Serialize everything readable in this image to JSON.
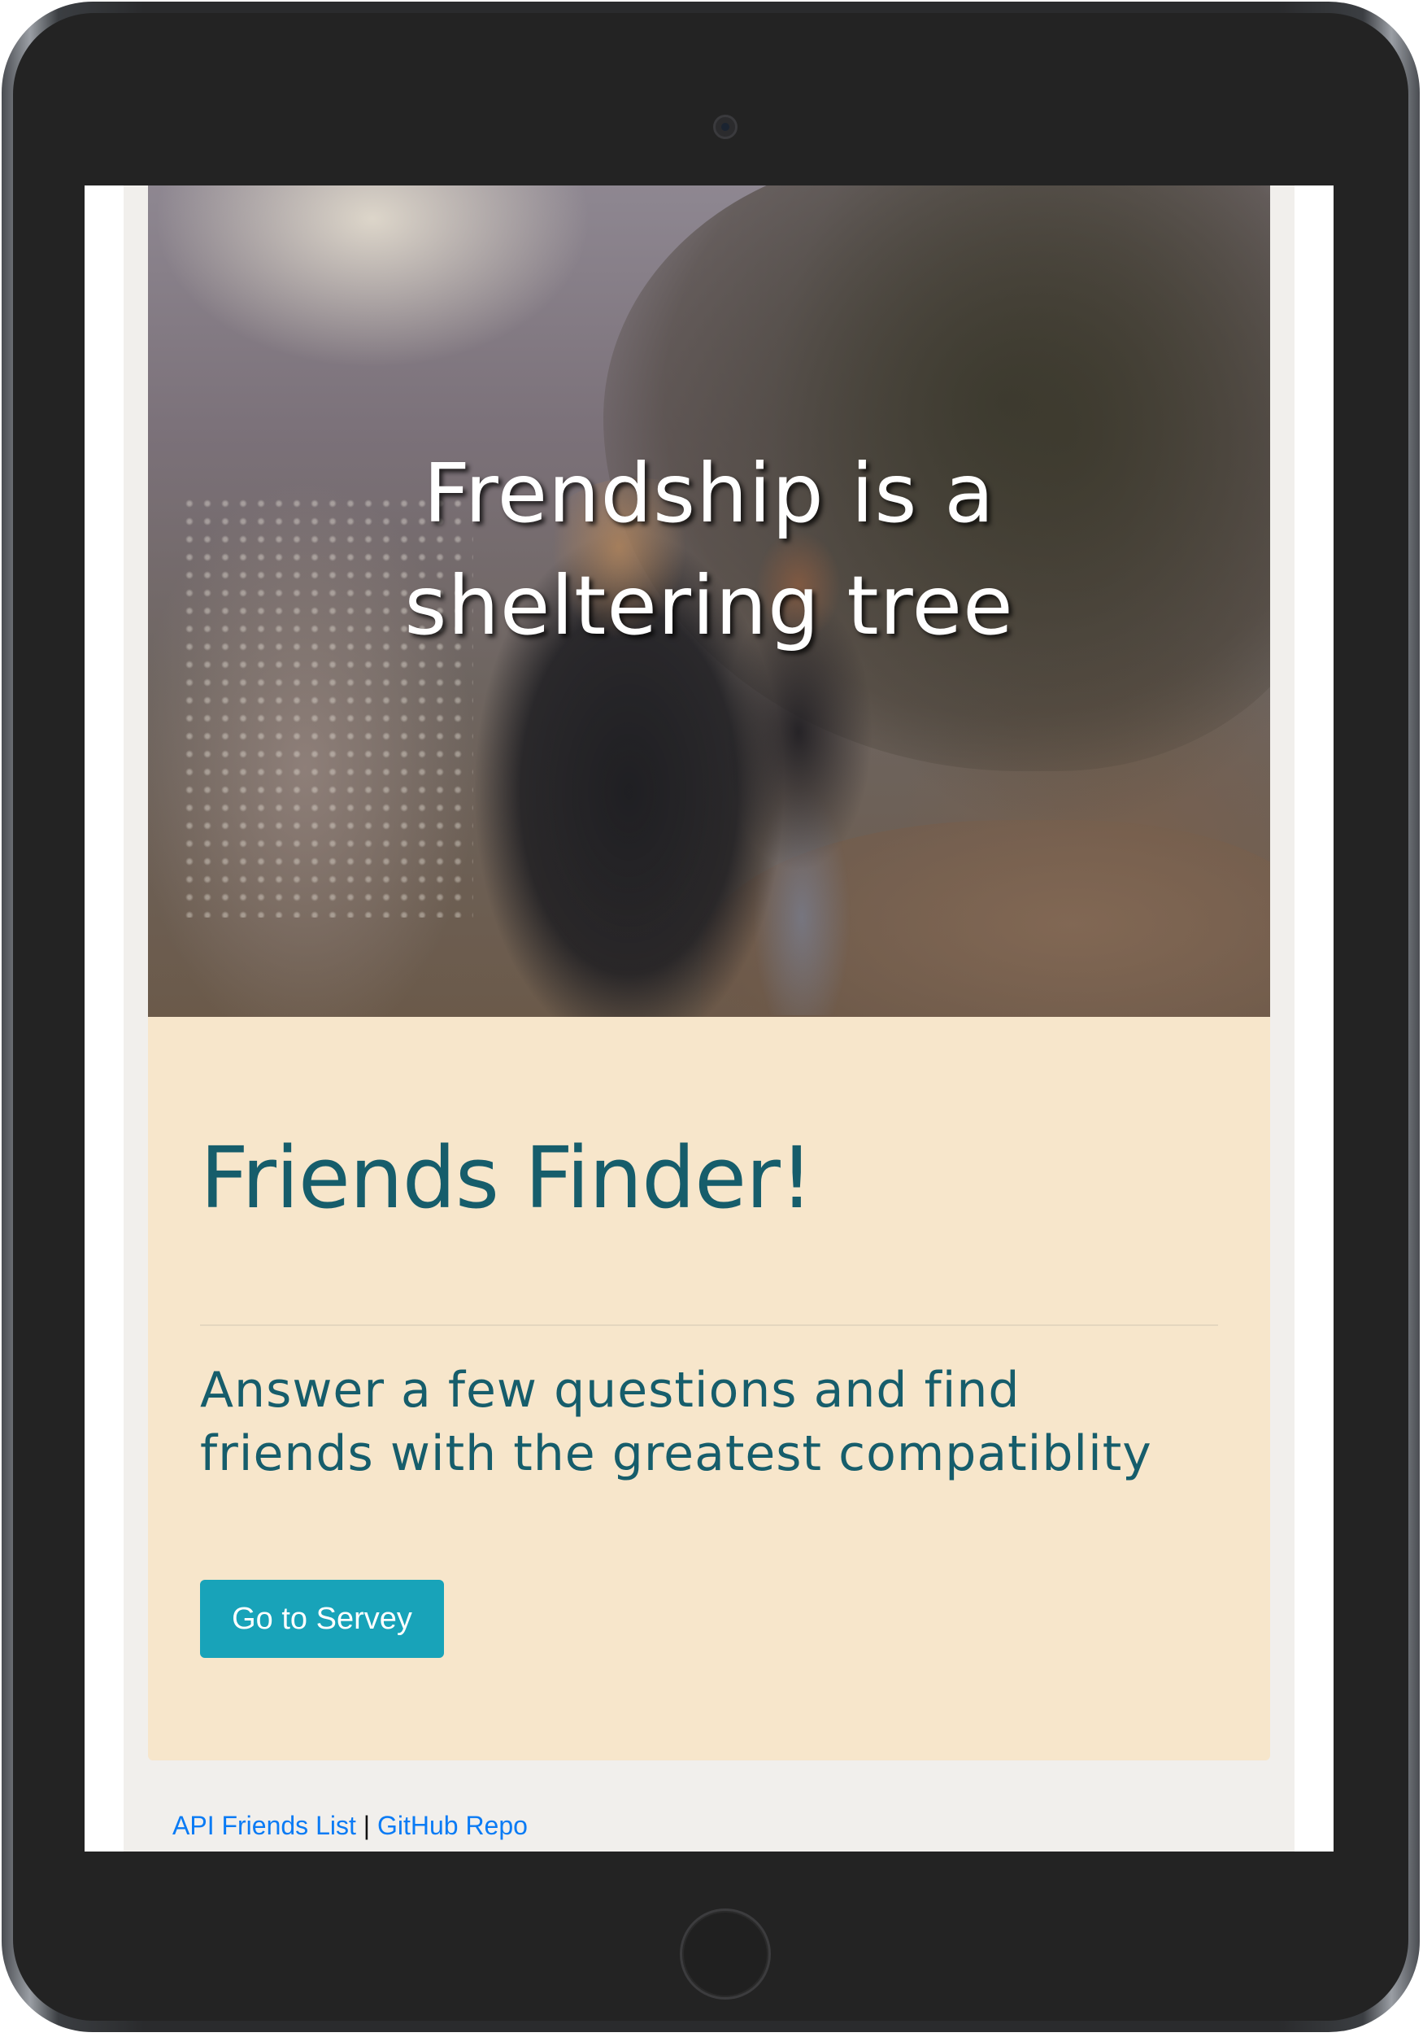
{
  "hero": {
    "title_line1": "Frendship is a",
    "title_line2": "sheltering tree"
  },
  "jumbotron": {
    "title": "Friends Finder!",
    "lead_line1": "Answer a few questions and find",
    "lead_line2": "friends with the greatest compatiblity",
    "button_label": "Go to Servey"
  },
  "footer": {
    "api_link": "API Friends List",
    "separator": "|",
    "github_link": "GitHub Repo"
  },
  "colors": {
    "jumbotron_bg": "#f7e6cb",
    "heading_text": "#165d6b",
    "button_bg": "#18a3b9",
    "link": "#0a7bf5",
    "device_frame": "#232323"
  }
}
